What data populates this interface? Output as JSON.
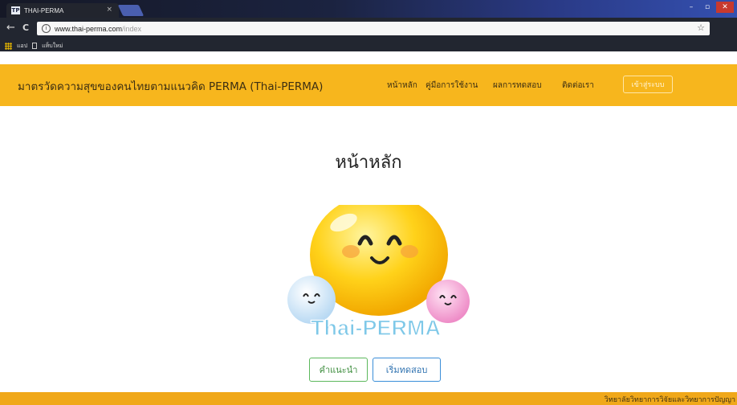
{
  "browser": {
    "tab_title": "THAI-PERMA",
    "tab_favicon": "TP",
    "tab_close": "×",
    "url_host": "www.thai-perma.com",
    "url_path": "/index",
    "bookmarks": {
      "apps_label": "แอป",
      "new_tab_label": "แท็บใหม่"
    },
    "icons": {
      "back": "←",
      "reload": "C",
      "info": "i",
      "star": "☆",
      "minimize": "–",
      "maximize": "▫",
      "close": "✕"
    }
  },
  "navbar": {
    "brand": "มาตรวัดความสุขของคนไทยตามแนวคิด PERMA (Thai-PERMA)",
    "links": [
      "หน้าหลัก",
      "คู่มือการใช้งาน",
      "ผลการทดสอบ",
      "ติดต่อเรา"
    ],
    "login_label": "เข้าสู่ระบบ"
  },
  "main": {
    "title": "หน้าหลัก",
    "logo_text": "Thai-PERMA",
    "buttons": {
      "advice": "คำแนะนำ",
      "start": "เริ่มทดสอบ"
    }
  },
  "footer": {
    "text": "วิทยาลัยวิทยาการวิจัยและวิทยาการปัญญา"
  },
  "colors": {
    "navbar_bg": "#f7b61d",
    "footer_bg": "#f0a81a",
    "advice_border": "#5cb85c",
    "start_border": "#3a8ed8",
    "logo_text": "#7ec8e8"
  }
}
